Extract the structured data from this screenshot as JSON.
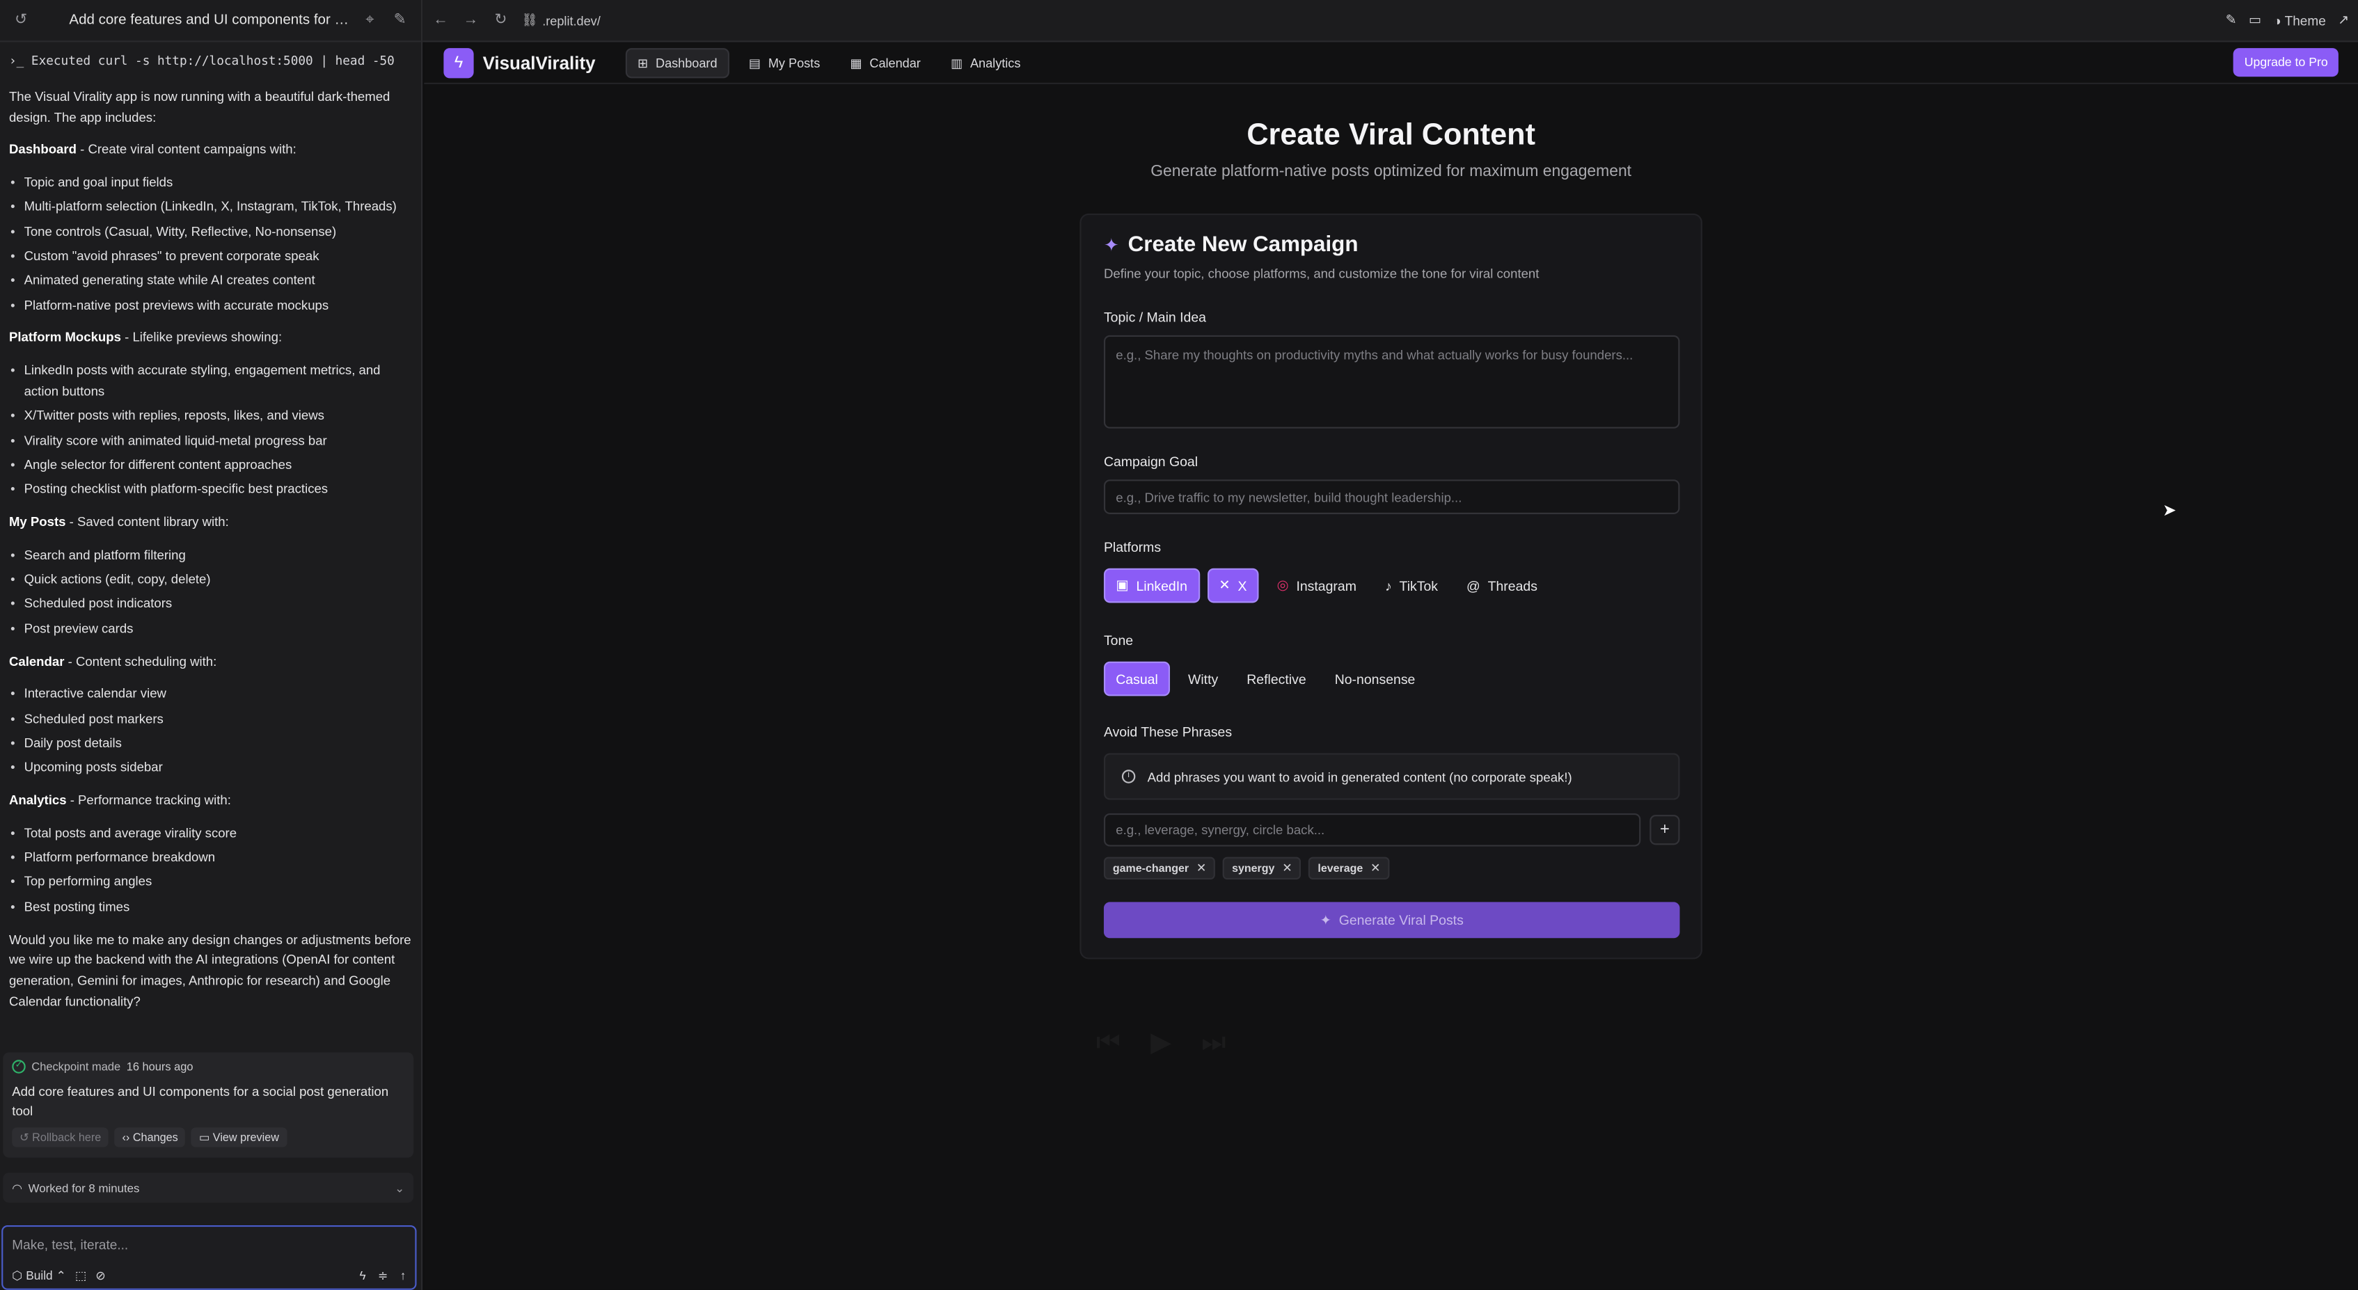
{
  "left_panel": {
    "title": "Add core features and UI components for a soc...",
    "executed": "Executed curl -s http://localhost:5000 | head -50",
    "intro": "The Visual Virality app is now running with a beautiful dark-themed design. The app includes:",
    "sections": [
      {
        "heading": "Dashboard",
        "desc": " - Create viral content campaigns with:",
        "items": [
          "Topic and goal input fields",
          "Multi-platform selection (LinkedIn, X, Instagram, TikTok, Threads)",
          "Tone controls (Casual, Witty, Reflective, No-nonsense)",
          "Custom \"avoid phrases\" to prevent corporate speak",
          "Animated generating state while AI creates content",
          "Platform-native post previews with accurate mockups"
        ]
      },
      {
        "heading": "Platform Mockups",
        "desc": " - Lifelike previews showing:",
        "items": [
          "LinkedIn posts with accurate styling, engagement metrics, and action buttons",
          "X/Twitter posts with replies, reposts, likes, and views",
          "Virality score with animated liquid-metal progress bar",
          "Angle selector for different content approaches",
          "Posting checklist with platform-specific best practices"
        ]
      },
      {
        "heading": "My Posts",
        "desc": " - Saved content library with:",
        "items": [
          "Search and platform filtering",
          "Quick actions (edit, copy, delete)",
          "Scheduled post indicators",
          "Post preview cards"
        ]
      },
      {
        "heading": "Calendar",
        "desc": " - Content scheduling with:",
        "items": [
          "Interactive calendar view",
          "Scheduled post markers",
          "Daily post details",
          "Upcoming posts sidebar"
        ]
      },
      {
        "heading": "Analytics",
        "desc": " - Performance tracking with:",
        "items": [
          "Total posts and average virality score",
          "Platform performance breakdown",
          "Top performing angles",
          "Best posting times"
        ]
      }
    ],
    "closing": "Would you like me to make any design changes or adjustments before we wire up the backend with the AI integrations (OpenAI for content generation, Gemini for images, Anthropic for research) and Google Calendar functionality?",
    "checkpoint": {
      "label": "Checkpoint made",
      "when": "16 hours ago",
      "message": "Add core features and UI components for a social post generation tool",
      "rollback": "Rollback here",
      "changes": "Changes",
      "view_preview": "View preview"
    },
    "worked": "Worked for 8 minutes",
    "composer_placeholder": "Make, test, iterate...",
    "build_label": "Build"
  },
  "browser": {
    "url": ".replit.dev/",
    "theme_label": "Theme"
  },
  "app": {
    "brand": "VisualVirality",
    "nav": [
      {
        "label": "Dashboard",
        "active": true
      },
      {
        "label": "My Posts"
      },
      {
        "label": "Calendar"
      },
      {
        "label": "Analytics"
      }
    ],
    "upgrade": "Upgrade to Pro",
    "hero_title": "Create Viral Content",
    "hero_subtitle": "Generate platform-native posts optimized for maximum engagement",
    "card": {
      "title": "Create New Campaign",
      "subtitle": "Define your topic, choose platforms, and customize the tone for viral content",
      "topic_label": "Topic / Main Idea",
      "topic_placeholder": "e.g., Share my thoughts on productivity myths and what actually works for busy founders...",
      "goal_label": "Campaign Goal",
      "goal_placeholder": "e.g., Drive traffic to my newsletter, build thought leadership...",
      "platforms_label": "Platforms",
      "platforms": [
        {
          "label": "LinkedIn",
          "selected": true
        },
        {
          "label": "X",
          "selected": true
        },
        {
          "label": "Instagram",
          "selected": false
        },
        {
          "label": "TikTok",
          "selected": false
        },
        {
          "label": "Threads",
          "selected": false
        }
      ],
      "tone_label": "Tone",
      "tones": [
        {
          "label": "Casual",
          "selected": true
        },
        {
          "label": "Witty",
          "selected": false
        },
        {
          "label": "Reflective",
          "selected": false
        },
        {
          "label": "No-nonsense",
          "selected": false
        }
      ],
      "avoid_label": "Avoid These Phrases",
      "avoid_info": "Add phrases you want to avoid in generated content (no corporate speak!)",
      "phrase_placeholder": "e.g., leverage, synergy, circle back...",
      "tags": [
        "game-changer",
        "synergy",
        "leverage"
      ],
      "generate": "Generate Viral Posts"
    }
  },
  "colors": {
    "accent": "#8b5cf6",
    "background": "#111112",
    "panel": "#1c1c1e"
  }
}
